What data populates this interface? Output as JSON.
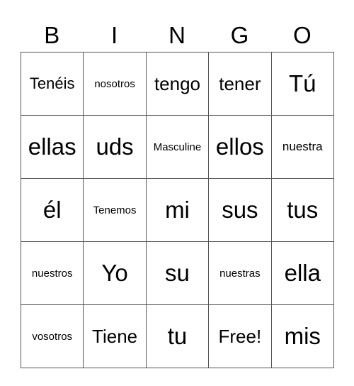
{
  "header": [
    "B",
    "I",
    "N",
    "G",
    "O"
  ],
  "rows": [
    [
      "Tenéis",
      "nosotros",
      "tengo",
      "tener",
      "Tú"
    ],
    [
      "ellas",
      "uds",
      "Masculine",
      "ellos",
      "nuestra"
    ],
    [
      "él",
      "Tenemos",
      "mi",
      "sus",
      "tus"
    ],
    [
      "nuestros",
      "Yo",
      "su",
      "nuestras",
      "ella"
    ],
    [
      "vosotros",
      "Tiene",
      "tu",
      "Free!",
      "mis"
    ]
  ]
}
